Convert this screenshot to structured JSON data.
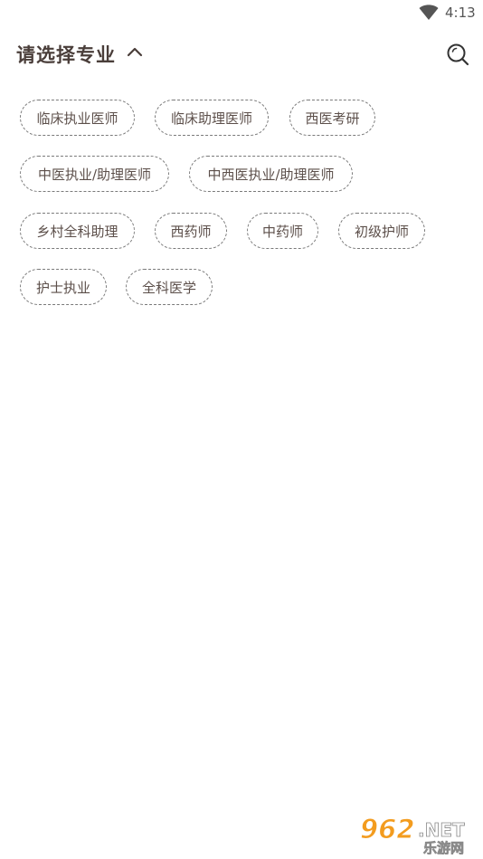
{
  "status_bar": {
    "time": "4:13"
  },
  "header": {
    "title": "请选择专业"
  },
  "majors": [
    "临床执业医师",
    "临床助理医师",
    "西医考研",
    "中医执业/助理医师",
    "中西医执业/助理医师",
    "乡村全科助理",
    "西药师",
    "中药师",
    "初级护师",
    "护士执业",
    "全科医学"
  ],
  "watermark": {
    "number": "962",
    "suffix": ".NET",
    "subtitle": "乐游网"
  },
  "colors": {
    "text": "#4a3e3a",
    "tag_border": "#7a7a7a",
    "watermark_orange": "#f39c1f"
  },
  "icons": {
    "wifi": "wifi-icon",
    "chevron": "chevron-up-icon",
    "search": "search-icon"
  }
}
